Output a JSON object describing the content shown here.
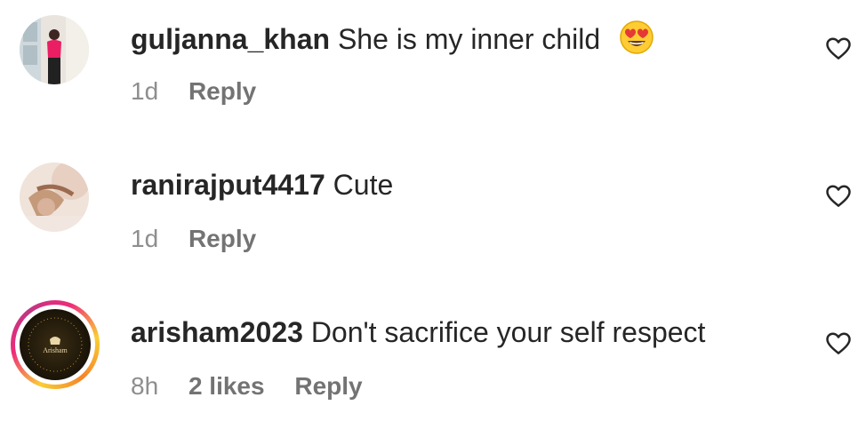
{
  "comments": [
    {
      "username": "guljanna_khan",
      "text": "She is my inner child",
      "emoji": "smiling-face-with-heart-eyes",
      "time": "1d",
      "likes": "",
      "reply_label": "Reply"
    },
    {
      "username": "ranirajput4417",
      "text": "Cute",
      "time": "1d",
      "likes": "",
      "reply_label": "Reply"
    },
    {
      "username": "arisham2023",
      "text": "Don't sacrifice your self respect",
      "time": "8h",
      "likes": "2 likes",
      "reply_label": "Reply",
      "has_story_ring": true,
      "avatar_logo": "Arisham"
    }
  ],
  "colors": {
    "text": "#262626",
    "secondary": "#8e8e8e",
    "story_ring": [
      "#f9ce34",
      "#ee2a7b",
      "#c13584"
    ]
  }
}
